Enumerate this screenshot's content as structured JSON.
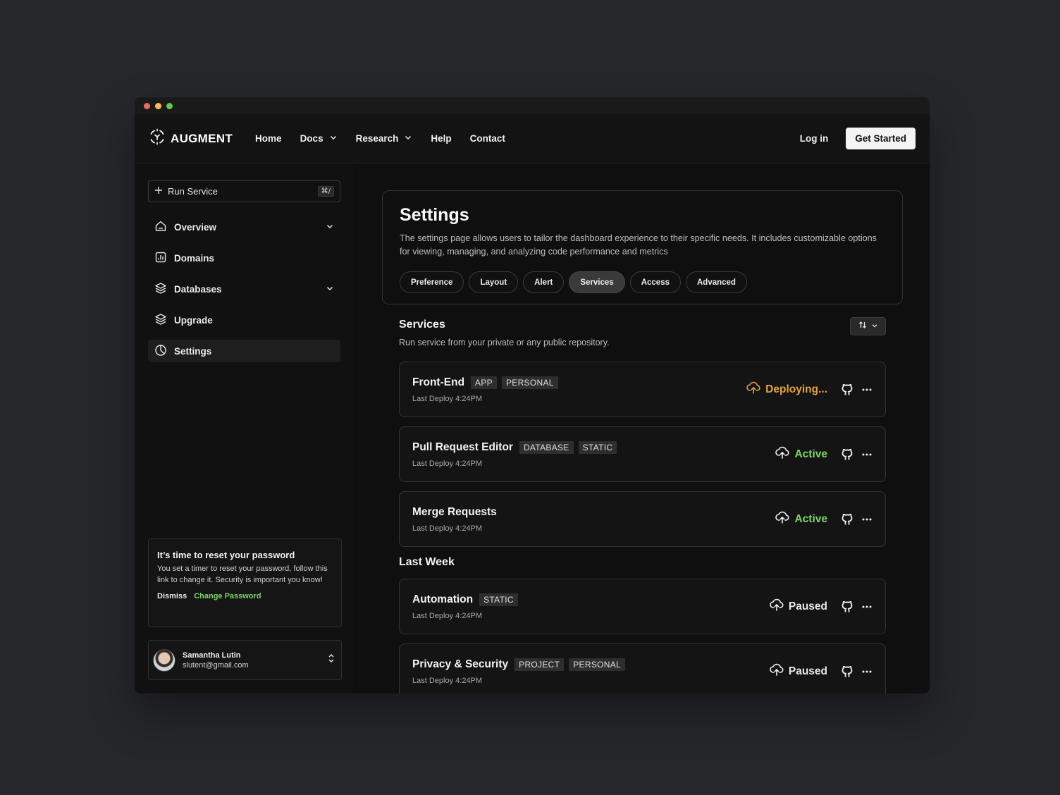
{
  "brand": {
    "name": "AUGMENT"
  },
  "nav": {
    "links": [
      "Home",
      "Docs",
      "Research",
      "Help",
      "Contact"
    ],
    "login": "Log in",
    "cta": "Get Started"
  },
  "sidebar": {
    "run_service": {
      "label": "Run Service",
      "shortcut": "⌘/"
    },
    "items": [
      {
        "label": "Overview",
        "icon": "home-icon"
      },
      {
        "label": "Domains",
        "icon": "chart-icon"
      },
      {
        "label": "Databases",
        "icon": "layers-icon"
      },
      {
        "label": "Upgrade",
        "icon": "layers-icon"
      },
      {
        "label": "Settings",
        "icon": "pie-icon"
      }
    ],
    "notice": {
      "title": "It’s time to reset your password",
      "text": "You set a timer to reset your password, follow this link to change it. Security is important you know!",
      "dismiss": "Dismiss",
      "action": "Change Password"
    },
    "user": {
      "name": "Samantha Lutin",
      "email": "slutent@gmail.com"
    }
  },
  "settings": {
    "title": "Settings",
    "description": "The settings page allows users to tailor the dashboard experience to their specific needs. It includes customizable options for viewing, managing, and analyzing code performance and metrics",
    "tabs": [
      "Preference",
      "Layout",
      "Alert",
      "Services",
      "Access",
      "Advanced"
    ],
    "active_tab": "Services"
  },
  "services": {
    "title": "Services",
    "subtitle": "Run service from your private or any public repository.",
    "current": [
      {
        "name": "Front-End",
        "tags": [
          "APP",
          "PERSONAL"
        ],
        "meta": "Last Deploy 4:24PM",
        "status": "Deploying..."
      },
      {
        "name": "Pull Request Editor",
        "tags": [
          "DATABASE",
          "STATIC"
        ],
        "meta": "Last Deploy 4:24PM",
        "status": "Active"
      },
      {
        "name": "Merge Requests",
        "tags": [],
        "meta": "Last Deploy 4:24PM",
        "status": "Active"
      }
    ],
    "last_week_title": "Last Week",
    "last_week": [
      {
        "name": "Automation",
        "tags": [
          "STATIC"
        ],
        "meta": "Last Deploy 4:24PM",
        "status": "Paused"
      },
      {
        "name": "Privacy & Security",
        "tags": [
          "PROJECT",
          "PERSONAL"
        ],
        "meta": "Last Deploy 4:24PM",
        "status": "Paused"
      }
    ]
  },
  "colors": {
    "deploying": "#e2a23a",
    "active": "#7ed36a",
    "paused": "#e8e8e8",
    "background": "#26272b",
    "window": "#101010"
  }
}
